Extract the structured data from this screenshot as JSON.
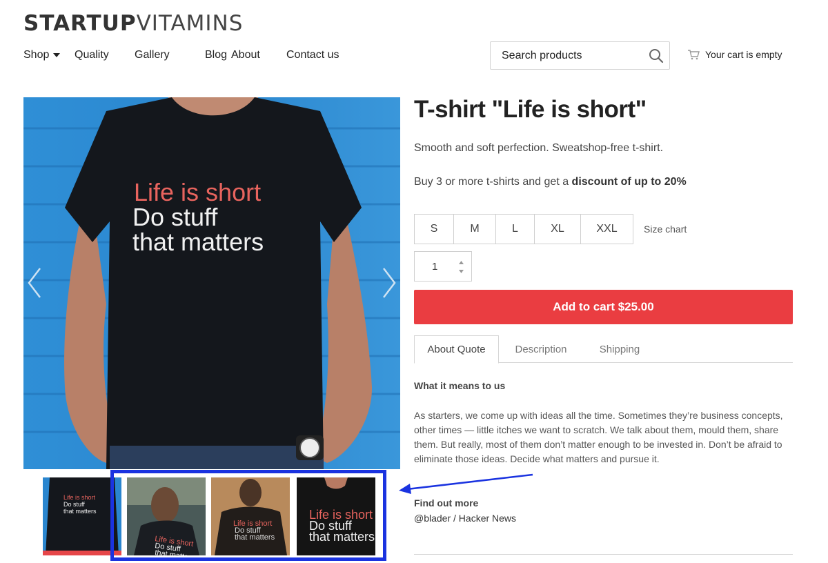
{
  "header": {
    "logo_bold": "STARTUP",
    "logo_light": "VITAMINS",
    "nav": [
      {
        "label": "Shop"
      },
      {
        "label": "Quality"
      },
      {
        "label": "Gallery"
      },
      {
        "label": "Blog"
      },
      {
        "label": "About"
      },
      {
        "label": "Contact us"
      }
    ],
    "search_placeholder": "Search products",
    "cart_label": "Your cart is empty"
  },
  "gallery": {
    "main_shirt_text": [
      "Life is short",
      "Do stuff",
      "that matters"
    ],
    "thumb_shirt_text": [
      [
        "Life is short",
        "Do stuff",
        "that matters"
      ],
      [
        "Life is short",
        "Do stuff",
        "that matter"
      ],
      [
        "Life is short",
        "Do stuff",
        "that matters"
      ],
      [
        "Life is short",
        "Do stuff",
        "that matters"
      ]
    ]
  },
  "product": {
    "title": "T-shirt \"Life is short\"",
    "subtitle": "Smooth and soft perfection. Sweatshop-free t-shirt.",
    "discount_prefix": "Buy 3 or more t-shirts and get a ",
    "discount_bold": "discount of up to 20%",
    "sizes": [
      "S",
      "M",
      "L",
      "XL",
      "XXL"
    ],
    "size_chart": "Size chart",
    "quantity": "1",
    "add_to_cart": "Add to cart $25.00",
    "tabs": [
      "About Quote",
      "Description",
      "Shipping"
    ],
    "about_heading": "What it means to us",
    "about_body": "As starters, we come up with ideas all the time. Sometimes they’re business concepts, other times — little itches we want to scratch. We talk about them, mould them, share them. But really, most of them don’t matter enough to be invested in. Don’t be afraid to eliminate those ideas. Decide what matters and pursue it.",
    "findout_heading": "Find out more",
    "source": "@blader / Hacker News"
  },
  "colors": {
    "accent_red": "#ea3d41",
    "annotation_blue": "#1a33e0",
    "backdrop_blue": "#2a86cf",
    "shirt_black": "#14171c",
    "shirt_text_red": "#e8645e"
  }
}
